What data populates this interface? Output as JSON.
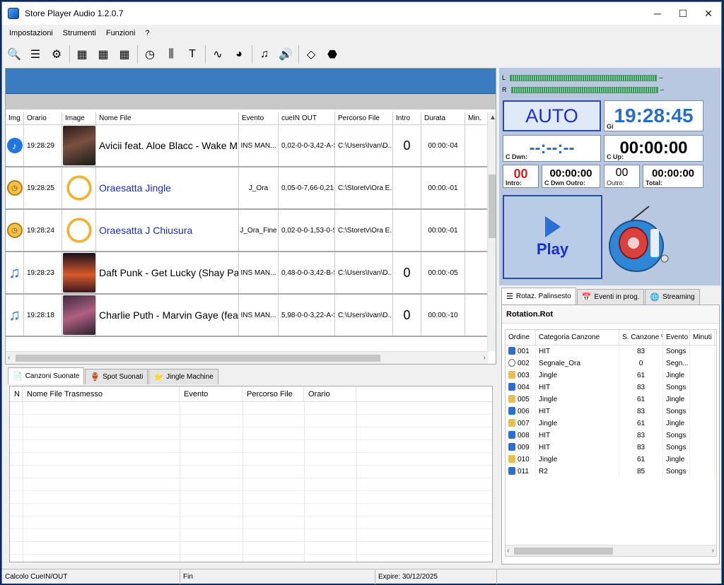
{
  "window": {
    "title": "Store Player Audio 1.2.0.7",
    "minimize": "─",
    "maximize": "☐",
    "close": "✕"
  },
  "menu": [
    "Impostazioni",
    "Strumenti",
    "Funzioni",
    "?"
  ],
  "toolbar": [
    {
      "name": "search-icon",
      "glyph": "🔍"
    },
    {
      "name": "list-icon",
      "glyph": "☰"
    },
    {
      "name": "gear-icon",
      "glyph": "⚙"
    },
    {
      "name": "calendar-icon",
      "glyph": "▦"
    },
    {
      "name": "calendar-blue-icon",
      "glyph": "▦"
    },
    {
      "name": "calendar-green-icon",
      "glyph": "▦"
    },
    {
      "name": "clock-icon",
      "glyph": "◷"
    },
    {
      "name": "mixer-icon",
      "glyph": "⫼"
    },
    {
      "name": "hammer-icon",
      "glyph": "T"
    },
    {
      "name": "waveform-icon",
      "glyph": "∿"
    },
    {
      "name": "pie-chart-icon",
      "glyph": "◕"
    },
    {
      "name": "music-note-icon",
      "glyph": "♫"
    },
    {
      "name": "speaker-icon",
      "glyph": "🔊"
    },
    {
      "name": "eraser-icon",
      "glyph": "◇"
    },
    {
      "name": "stop-icon",
      "glyph": "⬣"
    }
  ],
  "playlist": {
    "headers": [
      "Img",
      "Orario",
      "Image",
      "Nome File",
      "Evento",
      "cueIN  OUT",
      "Percorso File",
      "Intro",
      "Durata",
      "Min."
    ],
    "rows": [
      {
        "icon": "note-round",
        "icon_glyph": "♪",
        "time": "19:28:29",
        "thumb": "cover1",
        "name": "Avicii feat. Aloe Blacc - Wake M...",
        "name_blue": false,
        "event": "INS MAN...",
        "cue": "0,02-0-0-3,42-A-S",
        "path": "C:\\Users\\Ivan\\D...",
        "intro": "0",
        "duration": "00:00:-04"
      },
      {
        "icon": "clock",
        "icon_glyph": "◷",
        "time": "19:28:25",
        "thumb": "clockimg",
        "name": "Oraesatta Jingle",
        "name_blue": true,
        "event": "J_Ora",
        "cue": "0,05-0-7,66-0,21-...",
        "path": "C:\\Storetv\\Ora E...",
        "intro": "",
        "duration": "00:00:-01"
      },
      {
        "icon": "clock",
        "icon_glyph": "◷",
        "time": "19:28:24",
        "thumb": "clockimg",
        "name": "Oraesatta J Chiusura",
        "name_blue": true,
        "event": "J_Ora_Fine",
        "cue": "0,02-0-0-1,53-0-S",
        "path": "C:\\Storetv\\Ora E...",
        "intro": "",
        "duration": "00:00:-01"
      },
      {
        "icon": "note",
        "icon_glyph": "♫",
        "time": "19:28:23",
        "thumb": "cover2",
        "name": "Daft Punk - Get Lucky (Shay Palt...",
        "name_blue": false,
        "event": "INS MAN...",
        "cue": "0,48-0-0-3,42-B-S",
        "path": "C:\\Users\\Ivan\\D...",
        "intro": "0",
        "duration": "00:00:-05"
      },
      {
        "icon": "note",
        "icon_glyph": "♫",
        "time": "19:28:18",
        "thumb": "cover3",
        "name": "Charlie Puth - Marvin Gaye (feat. ...",
        "name_blue": false,
        "event": "INS MAN...",
        "cue": "5,98-0-0-3,22-A-S",
        "path": "C:\\Users\\Ivan\\D...",
        "intro": "0",
        "duration": "00:00:-10"
      }
    ]
  },
  "bottom_tabs": [
    {
      "label": "Canzoni Suonate",
      "glyph": "📄",
      "active": true
    },
    {
      "label": "Spot Suonati",
      "glyph": "🏺",
      "active": false
    },
    {
      "label": "Jingle Machine",
      "glyph": "⭐",
      "active": false
    }
  ],
  "history": {
    "headers": [
      "N",
      "Nome File Trasmesso",
      "Evento",
      "Percorso File",
      "Orario"
    ]
  },
  "status": {
    "left": "Calcolo CueIN/OUT",
    "mid": "Fin",
    "expire": "Expire: 30/12/2025"
  },
  "player": {
    "meter_l": "L",
    "meter_r": "R",
    "meter_end": "--",
    "mode": "AUTO",
    "clock": "19:28:45",
    "clock_label": "Gi",
    "c_dwn": "--:--:--",
    "c_dwn_label": "C Dwn:",
    "c_up": "00:00:00",
    "c_up_label": "C Up:",
    "intro": "00",
    "intro_label": "Intro:",
    "c_dwn_outro": "00:00:00",
    "c_dwn_outro_label": "C Dwn Outro:",
    "outro": "00",
    "outro_label": "Outro:",
    "total": "00:00:00",
    "total_label": "Total:",
    "play_label": "Play"
  },
  "right_tabs": [
    {
      "label": "Rotaz. Palinsesto",
      "glyph": "☰",
      "active": true
    },
    {
      "label": "Eventi in prog.",
      "glyph": "📅",
      "active": false
    },
    {
      "label": "Streaming",
      "glyph": "🌐",
      "active": false
    }
  ],
  "rotation": {
    "title": "Rotation.Rot",
    "headers": [
      "Ordine",
      "Categoria Canzone",
      "S. Canzone %",
      "Evento",
      "Minuti"
    ],
    "rows": [
      {
        "icon": "song",
        "order": "001",
        "cat": "HIT",
        "pct": "83",
        "event": "Songs"
      },
      {
        "icon": "clock",
        "order": "002",
        "cat": "Segnale_Ora",
        "pct": "0",
        "event": "Segn..."
      },
      {
        "icon": "jingle",
        "order": "003",
        "cat": "Jingle",
        "pct": "61",
        "event": "Jingle"
      },
      {
        "icon": "song",
        "order": "004",
        "cat": "HIT",
        "pct": "83",
        "event": "Songs"
      },
      {
        "icon": "jingle",
        "order": "005",
        "cat": "Jingle",
        "pct": "61",
        "event": "Jingle"
      },
      {
        "icon": "song",
        "order": "006",
        "cat": "HIT",
        "pct": "83",
        "event": "Songs"
      },
      {
        "icon": "jingle",
        "order": "007",
        "cat": "Jingle",
        "pct": "61",
        "event": "Jingle"
      },
      {
        "icon": "song",
        "order": "008",
        "cat": "HIT",
        "pct": "83",
        "event": "Songs"
      },
      {
        "icon": "song",
        "order": "009",
        "cat": "HIT",
        "pct": "83",
        "event": "Songs"
      },
      {
        "icon": "jingle",
        "order": "010",
        "cat": "Jingle",
        "pct": "61",
        "event": "Jingle"
      },
      {
        "icon": "song",
        "order": "011",
        "cat": "R2",
        "pct": "85",
        "event": "Songs"
      }
    ]
  }
}
